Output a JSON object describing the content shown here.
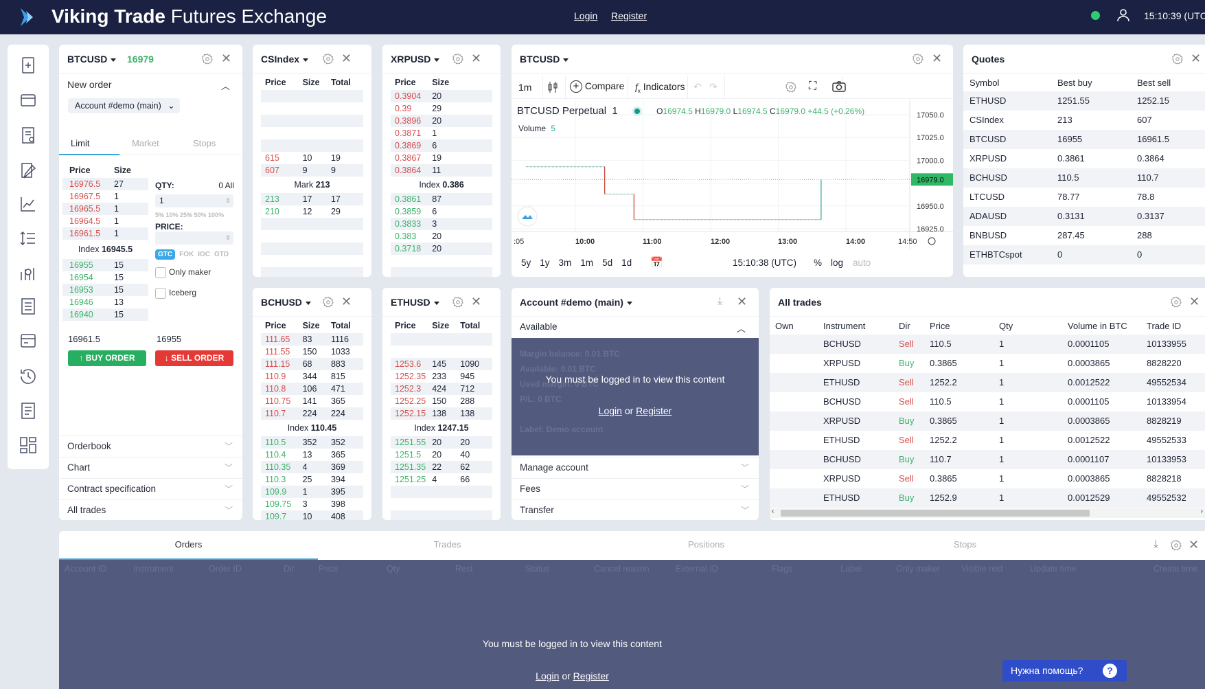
{
  "header": {
    "title_bold": "Viking Trade",
    "title_rest": " Futures Exchange",
    "login": "Login",
    "register": "Register",
    "time": "15:10:39 (UTC",
    "status_color": "#2ecc71"
  },
  "sidebar": {
    "icons": [
      "new-document-icon",
      "card-icon",
      "report-icon",
      "edit-document-icon",
      "line-chart-icon",
      "list-numbered-icon",
      "analytics-icon",
      "document-list-icon",
      "wallet-icon",
      "history-icon",
      "notes-icon",
      "layout-icon"
    ]
  },
  "colors": {
    "ask": "#d4504f",
    "bid": "#3db26b",
    "overlay": "#525a7e",
    "header": "#1b2142",
    "buy": "#27ae60",
    "sell": "#e53935"
  },
  "order_panel": {
    "symbol": "BTCUSD",
    "last_price": "16979",
    "section": "New order",
    "account": "Account #demo (main)",
    "tabs": [
      "Limit",
      "Market",
      "Stops"
    ],
    "active_tab": "Limit",
    "book_headers": [
      "Price",
      "Size"
    ],
    "asks": [
      [
        "16976.5",
        "27"
      ],
      [
        "16967.5",
        "1"
      ],
      [
        "16965.5",
        "1"
      ],
      [
        "16964.5",
        "1"
      ],
      [
        "16961.5",
        "1"
      ]
    ],
    "index_label": "Index",
    "index_value": "16945.5",
    "bids": [
      [
        "16955",
        "15"
      ],
      [
        "16954",
        "15"
      ],
      [
        "16953",
        "15"
      ],
      [
        "16946",
        "13"
      ],
      [
        "16940",
        "15"
      ]
    ],
    "qty_label": "QTY:",
    "qty_right": "0 All",
    "qty_value": "1",
    "percents": "5% 10% 25% 50% 100%",
    "price_label": "PRICE:",
    "price_value": "",
    "tif": [
      "GTC",
      "FOK",
      "IOC",
      "GTD"
    ],
    "tif_active": "GTC",
    "only_maker": "Only maker",
    "iceberg": "Iceberg",
    "best_sell": "16961.5",
    "best_buy": "16955",
    "buy_label": "BUY ORDER",
    "sell_label": "SELL ORDER",
    "sections": [
      "Orderbook",
      "Chart",
      "Contract specification",
      "All trades"
    ]
  },
  "orderbooks": [
    {
      "symbol": "CSIndex",
      "headers": [
        "Price",
        "Size",
        "Total"
      ],
      "asks": [
        [],
        [],
        [],
        [],
        [],
        [
          "615",
          "10",
          "19"
        ],
        [
          "607",
          "9",
          "9"
        ]
      ],
      "mid_label": "Mark",
      "mid_value": "213",
      "bids": [
        [
          "213",
          "17",
          "17"
        ],
        [
          "210",
          "12",
          "29"
        ],
        [],
        [],
        [],
        [],
        []
      ]
    },
    {
      "symbol": "XRPUSD",
      "headers": [
        "Price",
        "Size"
      ],
      "asks": [
        [
          "0.3904",
          "20"
        ],
        [
          "0.39",
          "29"
        ],
        [
          "0.3896",
          "20"
        ],
        [
          "0.3871",
          "1"
        ],
        [
          "0.3869",
          "6"
        ],
        [
          "0.3867",
          "19"
        ],
        [
          "0.3864",
          "11"
        ]
      ],
      "mid_label": "Index",
      "mid_value": "0.386",
      "bids": [
        [
          "0.3861",
          "87"
        ],
        [
          "0.3859",
          "6"
        ],
        [
          "0.3833",
          "3"
        ],
        [
          "0.383",
          "20"
        ],
        [
          "0.3718",
          "20"
        ],
        [],
        []
      ]
    },
    {
      "symbol": "BCHUSD",
      "headers": [
        "Price",
        "Size",
        "Total"
      ],
      "asks": [
        [
          "111.65",
          "83",
          "1116"
        ],
        [
          "111.55",
          "150",
          "1033"
        ],
        [
          "111.15",
          "68",
          "883"
        ],
        [
          "110.9",
          "344",
          "815"
        ],
        [
          "110.8",
          "106",
          "471"
        ],
        [
          "110.75",
          "141",
          "365"
        ],
        [
          "110.7",
          "224",
          "224"
        ]
      ],
      "mid_label": "Index",
      "mid_value": "110.45",
      "bids": [
        [
          "110.5",
          "352",
          "352"
        ],
        [
          "110.4",
          "13",
          "365"
        ],
        [
          "110.35",
          "4",
          "369"
        ],
        [
          "110.3",
          "25",
          "394"
        ],
        [
          "109.9",
          "1",
          "395"
        ],
        [
          "109.75",
          "3",
          "398"
        ],
        [
          "109.7",
          "10",
          "408"
        ]
      ]
    },
    {
      "symbol": "ETHUSD",
      "headers": [
        "Price",
        "Size",
        "Total"
      ],
      "asks": [
        [],
        [],
        [
          "1253.6",
          "145",
          "1090"
        ],
        [
          "1252.35",
          "233",
          "945"
        ],
        [
          "1252.3",
          "424",
          "712"
        ],
        [
          "1252.25",
          "150",
          "288"
        ],
        [
          "1252.15",
          "138",
          "138"
        ]
      ],
      "mid_label": "Index",
      "mid_value": "1247.15",
      "bids": [
        [
          "1251.55",
          "20",
          "20"
        ],
        [
          "1251.5",
          "20",
          "40"
        ],
        [
          "1251.35",
          "22",
          "62"
        ],
        [
          "1251.25",
          "4",
          "66"
        ],
        [],
        [],
        []
      ]
    }
  ],
  "chart": {
    "symbol": "BTCUSD",
    "interval": "1m",
    "compare": "Compare",
    "indicators": "Indicators",
    "legend_name": "BTCUSD Perpetual",
    "legend_interval": "1",
    "o_label": "O",
    "o": "16974.5",
    "h_label": "H",
    "h": "16979.0",
    "l_label": "L",
    "l": "16974.5",
    "c_label": "C",
    "c": "16979.0",
    "change": "+44.5 (+0.26%)",
    "volume_label": "Volume",
    "volume": "5",
    "ranges": [
      "5y",
      "1y",
      "3m",
      "1m",
      "5d",
      "1d"
    ],
    "clock": "15:10:38 (UTC)",
    "pct": "%",
    "log": "log",
    "auto": "auto"
  },
  "chart_data": {
    "type": "line",
    "step": true,
    "yticks": [
      "17050.0",
      "17025.0",
      "17000.0",
      "16950.0",
      "16925.0"
    ],
    "ylim": [
      16925,
      17050
    ],
    "xticks": [
      ":05",
      "10:00",
      "11:00",
      "12:00",
      "13:00",
      "14:00",
      "14:50"
    ],
    "last_price": "16979.0",
    "last_price_color": "#2fb865",
    "points": [
      {
        "t": "09:16",
        "p": 16993
      },
      {
        "t": "10:26",
        "p": 16993
      },
      {
        "t": "10:26",
        "p": 16963
      },
      {
        "t": "10:52",
        "p": 16963
      },
      {
        "t": "10:52",
        "p": 16935
      },
      {
        "t": "13:38",
        "p": 16935
      },
      {
        "t": "13:38",
        "p": 16979
      }
    ]
  },
  "quotes": {
    "title": "Quotes",
    "headers": [
      "Symbol",
      "Best buy",
      "Best sell"
    ],
    "rows": [
      [
        "ETHUSD",
        "1251.55",
        "1252.15"
      ],
      [
        "CSIndex",
        "213",
        "607"
      ],
      [
        "BTCUSD",
        "16955",
        "16961.5"
      ],
      [
        "XRPUSD",
        "0.3861",
        "0.3864"
      ],
      [
        "BCHUSD",
        "110.5",
        "110.7"
      ],
      [
        "LTCUSD",
        "78.77",
        "78.8"
      ],
      [
        "ADAUSD",
        "0.3131",
        "0.3137"
      ],
      [
        "BNBUSD",
        "287.45",
        "288"
      ],
      [
        "ETHBTCspot",
        "0",
        "0"
      ]
    ]
  },
  "account": {
    "title": "Account #demo (main)",
    "available": "Available",
    "hidden": [
      "Margin balance:  0.01 BTC",
      "Available:  0.01 BTC",
      "Used margin:  0 BTC",
      "P/L:  0 BTC",
      "Label:  Demo account"
    ],
    "message": "You must be logged in to view this content",
    "login": "Login",
    "or": " or ",
    "register": "Register",
    "sections": [
      "Manage account",
      "Fees",
      "Transfer"
    ]
  },
  "all_trades": {
    "title": "All trades",
    "headers": [
      "Own",
      "Instrument",
      "Dir",
      "Price",
      "Qty",
      "Volume in BTC",
      "Trade ID"
    ],
    "rows": [
      [
        "",
        "BCHUSD",
        "Sell",
        "110.5",
        "1",
        "0.0001105",
        "10133955"
      ],
      [
        "",
        "XRPUSD",
        "Buy",
        "0.3865",
        "1",
        "0.0003865",
        "8828220"
      ],
      [
        "",
        "ETHUSD",
        "Sell",
        "1252.2",
        "1",
        "0.0012522",
        "49552534"
      ],
      [
        "",
        "BCHUSD",
        "Sell",
        "110.5",
        "1",
        "0.0001105",
        "10133954"
      ],
      [
        "",
        "XRPUSD",
        "Buy",
        "0.3865",
        "1",
        "0.0003865",
        "8828219"
      ],
      [
        "",
        "ETHUSD",
        "Sell",
        "1252.2",
        "1",
        "0.0012522",
        "49552533"
      ],
      [
        "",
        "BCHUSD",
        "Buy",
        "110.7",
        "1",
        "0.0001107",
        "10133953"
      ],
      [
        "",
        "XRPUSD",
        "Sell",
        "0.3865",
        "1",
        "0.0003865",
        "8828218"
      ],
      [
        "",
        "ETHUSD",
        "Buy",
        "1252.9",
        "1",
        "0.0012529",
        "49552532"
      ]
    ]
  },
  "bottom": {
    "tabs": [
      "Orders",
      "Trades",
      "Positions",
      "Stops"
    ],
    "active_tab": "Orders",
    "columns": [
      "Account ID",
      "Instrument",
      "Order ID",
      "Dir",
      "Price",
      "Qty",
      "Rest",
      "Status",
      "Cancel reason",
      "External ID",
      "Flags",
      "Label",
      "Only maker",
      "Visible rest",
      "Update time",
      "Create time"
    ],
    "message": "You must be logged in to view this content",
    "login": "Login",
    "or": " or ",
    "register": "Register"
  },
  "help": {
    "label": "Нужна помощь?",
    "icon": "?"
  }
}
